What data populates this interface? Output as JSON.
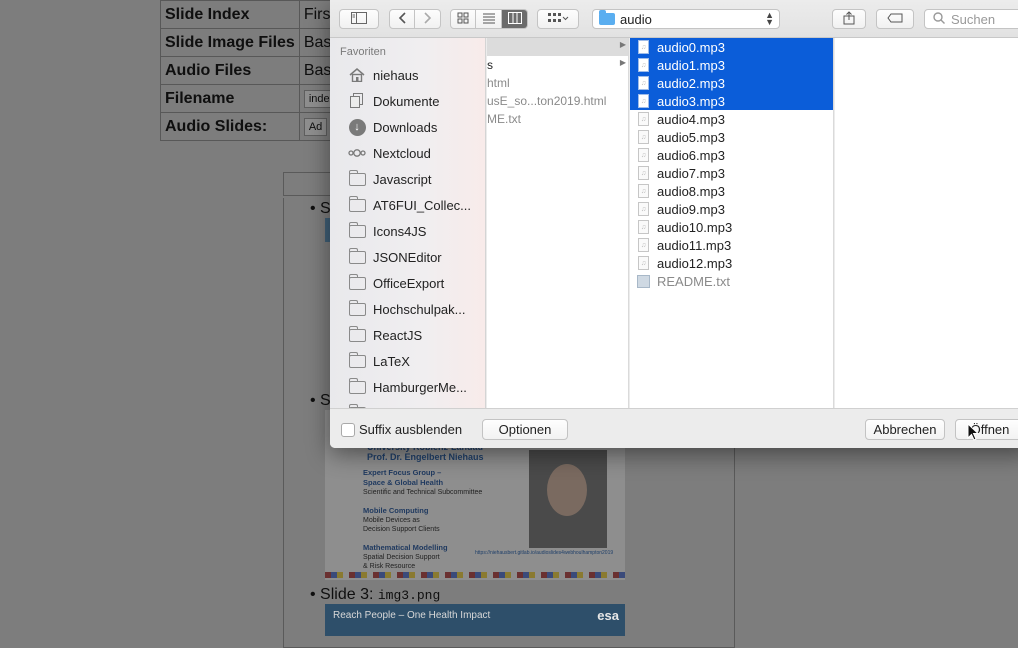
{
  "background_page": {
    "settings_rows": [
      {
        "label": "Slide Index",
        "value": "First"
      },
      {
        "label": "Slide Image Files",
        "value": "Base"
      },
      {
        "label": "Audio Files",
        "value": "Base"
      },
      {
        "label": "Filename",
        "value": "index"
      },
      {
        "label": "Audio Slides:",
        "value": "Ad"
      }
    ],
    "bullets": [
      {
        "text": "S"
      },
      {
        "text": "S"
      },
      {
        "text": "Slide 3: ",
        "code": "img3.png"
      }
    ],
    "slide2": {
      "university": "University Koblenz-Landau",
      "author": "Prof. Dr. Engelbert Niehaus",
      "lines": [
        {
          "title": "Expert Focus Group –",
          "sub": "Space & Global Health"
        },
        {
          "title": "",
          "sub": "Scientific and Technical Subcommittee"
        },
        {
          "title": "Mobile Computing",
          "sub": "Mobile Devices as"
        },
        {
          "title": "",
          "sub": "Decision Support Clients"
        },
        {
          "title": "Mathematical Modelling",
          "sub": "Spatial Decision Support"
        },
        {
          "title": "",
          "sub": "& Risk Resource"
        }
      ],
      "link": "https://niehausbert.gitlab.io/audioslides4webhoulhampton2019"
    },
    "slide3": {
      "title": "Reach People – One Health Impact",
      "logo": "esa"
    }
  },
  "dialog": {
    "toolbar": {
      "sidebar_icon": "sidebar-toggle-icon",
      "back": "‹",
      "forward": "›",
      "path": "audio",
      "search_placeholder": "Suchen"
    },
    "sidebar": {
      "header": "Favoriten",
      "items": [
        {
          "label": "niehaus",
          "icon": "home-icon"
        },
        {
          "label": "Dokumente",
          "icon": "documents-icon"
        },
        {
          "label": "Downloads",
          "icon": "downloads-icon"
        },
        {
          "label": "Nextcloud",
          "icon": "nextcloud-icon"
        },
        {
          "label": "Javascript",
          "icon": "folder-icon"
        },
        {
          "label": "AT6FUI_Collec...",
          "icon": "folder-icon"
        },
        {
          "label": "Icons4JS",
          "icon": "folder-icon"
        },
        {
          "label": "JSONEditor",
          "icon": "folder-icon"
        },
        {
          "label": "OfficeExport",
          "icon": "folder-icon"
        },
        {
          "label": "Hochschulpak...",
          "icon": "folder-icon"
        },
        {
          "label": "ReactJS",
          "icon": "folder-icon"
        },
        {
          "label": "LaTeX",
          "icon": "folder-icon"
        },
        {
          "label": "HamburgerMe...",
          "icon": "folder-icon"
        }
      ]
    },
    "parent_column": [
      {
        "label": "",
        "selected": true,
        "arrow": true
      },
      {
        "label": "s",
        "selected": false,
        "arrow": true
      },
      {
        "label": "html",
        "selected": false,
        "arrow": false
      },
      {
        "label": "usE_so...ton2019.html",
        "selected": false,
        "arrow": false
      },
      {
        "label": "ME.txt",
        "selected": false,
        "arrow": false
      }
    ],
    "files": [
      {
        "name": "audio0.mp3",
        "selected": true,
        "type": "audio"
      },
      {
        "name": "audio1.mp3",
        "selected": true,
        "type": "audio"
      },
      {
        "name": "audio2.mp3",
        "selected": true,
        "type": "audio"
      },
      {
        "name": "audio3.mp3",
        "selected": true,
        "type": "audio"
      },
      {
        "name": "audio4.mp3",
        "selected": false,
        "type": "audio"
      },
      {
        "name": "audio5.mp3",
        "selected": false,
        "type": "audio"
      },
      {
        "name": "audio6.mp3",
        "selected": false,
        "type": "audio"
      },
      {
        "name": "audio7.mp3",
        "selected": false,
        "type": "audio"
      },
      {
        "name": "audio8.mp3",
        "selected": false,
        "type": "audio"
      },
      {
        "name": "audio9.mp3",
        "selected": false,
        "type": "audio"
      },
      {
        "name": "audio10.mp3",
        "selected": false,
        "type": "audio"
      },
      {
        "name": "audio11.mp3",
        "selected": false,
        "type": "audio"
      },
      {
        "name": "audio12.mp3",
        "selected": false,
        "type": "audio"
      },
      {
        "name": "README.txt",
        "selected": false,
        "type": "text"
      }
    ],
    "bottom": {
      "hide_suffix_label": "Suffix ausblenden",
      "options_label": "Optionen",
      "cancel_label": "Abbrechen",
      "open_label": "Öffnen"
    },
    "colors": {
      "selection": "#0b5dd9",
      "folder_accent": "#5aaef0"
    }
  }
}
